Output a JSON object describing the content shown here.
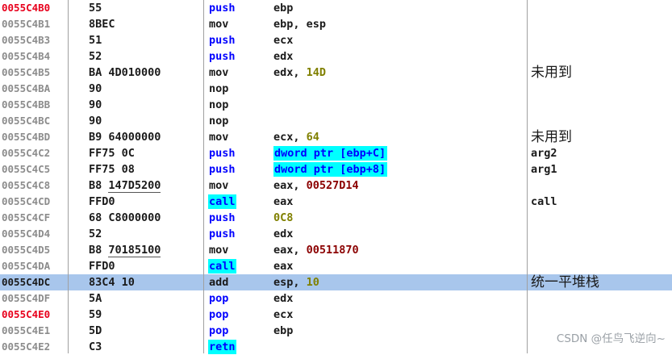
{
  "rows": [
    {
      "addr": "0055C4B0",
      "addr_style": "red",
      "hex": "55",
      "hex_ul": "",
      "mn": "push",
      "mn_style": "cyan",
      "op": [
        {
          "t": "ebp",
          "c": ""
        }
      ],
      "cm": "",
      "cm_cn": false,
      "selected": false
    },
    {
      "addr": "0055C4B1",
      "addr_style": "",
      "hex": "8BEC",
      "hex_ul": "",
      "mn": "mov",
      "mn_style": "",
      "op": [
        {
          "t": "ebp, esp",
          "c": ""
        }
      ],
      "cm": "",
      "cm_cn": false,
      "selected": false
    },
    {
      "addr": "0055C4B3",
      "addr_style": "",
      "hex": "51",
      "hex_ul": "",
      "mn": "push",
      "mn_style": "cyan",
      "op": [
        {
          "t": "ecx",
          "c": ""
        }
      ],
      "cm": "",
      "cm_cn": false,
      "selected": false
    },
    {
      "addr": "0055C4B4",
      "addr_style": "",
      "hex": "52",
      "hex_ul": "",
      "mn": "push",
      "mn_style": "cyan",
      "op": [
        {
          "t": "edx",
          "c": ""
        }
      ],
      "cm": "",
      "cm_cn": false,
      "selected": false
    },
    {
      "addr": "0055C4B5",
      "addr_style": "",
      "hex": "BA 4D010000",
      "hex_ul": "",
      "mn": "mov",
      "mn_style": "",
      "op": [
        {
          "t": "edx, ",
          "c": ""
        },
        {
          "t": "14D",
          "c": "num"
        }
      ],
      "cm": "未用到",
      "cm_cn": true,
      "selected": false
    },
    {
      "addr": "0055C4BA",
      "addr_style": "",
      "hex": "90",
      "hex_ul": "",
      "mn": "nop",
      "mn_style": "",
      "op": [],
      "cm": "",
      "cm_cn": false,
      "selected": false
    },
    {
      "addr": "0055C4BB",
      "addr_style": "",
      "hex": "90",
      "hex_ul": "",
      "mn": "nop",
      "mn_style": "",
      "op": [],
      "cm": "",
      "cm_cn": false,
      "selected": false
    },
    {
      "addr": "0055C4BC",
      "addr_style": "",
      "hex": "90",
      "hex_ul": "",
      "mn": "nop",
      "mn_style": "",
      "op": [],
      "cm": "",
      "cm_cn": false,
      "selected": false
    },
    {
      "addr": "0055C4BD",
      "addr_style": "",
      "hex": "B9 64000000",
      "hex_ul": "",
      "mn": "mov",
      "mn_style": "",
      "op": [
        {
          "t": "ecx, ",
          "c": ""
        },
        {
          "t": "64",
          "c": "num"
        }
      ],
      "cm": "未用到",
      "cm_cn": true,
      "selected": false
    },
    {
      "addr": "0055C4C2",
      "addr_style": "",
      "hex": "FF75 0C",
      "hex_ul": "",
      "mn": "push",
      "mn_style": "cyan",
      "op": [
        {
          "t": "dword ptr [ebp+C]",
          "c": "hlop"
        }
      ],
      "cm": "arg2",
      "cm_cn": false,
      "selected": false
    },
    {
      "addr": "0055C4C5",
      "addr_style": "",
      "hex": "FF75 08",
      "hex_ul": "",
      "mn": "push",
      "mn_style": "cyan",
      "op": [
        {
          "t": "dword ptr [ebp+8]",
          "c": "hlop"
        }
      ],
      "cm": "arg1",
      "cm_cn": false,
      "selected": false
    },
    {
      "addr": "0055C4C8",
      "addr_style": "",
      "hex": "B8 ",
      "hex_ul": "147D5200",
      "mn": "mov",
      "mn_style": "",
      "op": [
        {
          "t": "eax, ",
          "c": ""
        },
        {
          "t": "00527D14",
          "c": "addrnum"
        }
      ],
      "cm": "",
      "cm_cn": false,
      "selected": false
    },
    {
      "addr": "0055C4CD",
      "addr_style": "",
      "hex": "FFD0",
      "hex_ul": "",
      "mn": "call",
      "mn_style": "hl",
      "op": [
        {
          "t": "eax",
          "c": ""
        }
      ],
      "cm": "call",
      "cm_cn": false,
      "selected": false
    },
    {
      "addr": "0055C4CF",
      "addr_style": "",
      "hex": "68 C8000000",
      "hex_ul": "",
      "mn": "push",
      "mn_style": "cyan",
      "op": [
        {
          "t": "0C8",
          "c": "num"
        }
      ],
      "cm": "",
      "cm_cn": false,
      "selected": false
    },
    {
      "addr": "0055C4D4",
      "addr_style": "",
      "hex": "52",
      "hex_ul": "",
      "mn": "push",
      "mn_style": "cyan",
      "op": [
        {
          "t": "edx",
          "c": ""
        }
      ],
      "cm": "",
      "cm_cn": false,
      "selected": false
    },
    {
      "addr": "0055C4D5",
      "addr_style": "",
      "hex": "B8 ",
      "hex_ul": "70185100",
      "mn": "mov",
      "mn_style": "",
      "op": [
        {
          "t": "eax, ",
          "c": ""
        },
        {
          "t": "00511870",
          "c": "addrnum"
        }
      ],
      "cm": "",
      "cm_cn": false,
      "selected": false
    },
    {
      "addr": "0055C4DA",
      "addr_style": "",
      "hex": "FFD0",
      "hex_ul": "",
      "mn": "call",
      "mn_style": "hl",
      "op": [
        {
          "t": "eax",
          "c": ""
        }
      ],
      "cm": "",
      "cm_cn": false,
      "selected": false
    },
    {
      "addr": "0055C4DC",
      "addr_style": "dark",
      "hex": "83C4 10",
      "hex_ul": "",
      "mn": "add",
      "mn_style": "",
      "op": [
        {
          "t": "esp, ",
          "c": ""
        },
        {
          "t": "10",
          "c": "num"
        }
      ],
      "cm": "统一平堆栈",
      "cm_cn": true,
      "selected": true
    },
    {
      "addr": "0055C4DF",
      "addr_style": "",
      "hex": "5A",
      "hex_ul": "",
      "mn": "pop",
      "mn_style": "cyan",
      "op": [
        {
          "t": "edx",
          "c": ""
        }
      ],
      "cm": "",
      "cm_cn": false,
      "selected": false
    },
    {
      "addr": "0055C4E0",
      "addr_style": "red",
      "hex": "59",
      "hex_ul": "",
      "mn": "pop",
      "mn_style": "cyan",
      "op": [
        {
          "t": "ecx",
          "c": ""
        }
      ],
      "cm": "",
      "cm_cn": false,
      "selected": false
    },
    {
      "addr": "0055C4E1",
      "addr_style": "",
      "hex": "5D",
      "hex_ul": "",
      "mn": "pop",
      "mn_style": "cyan",
      "op": [
        {
          "t": "ebp",
          "c": ""
        }
      ],
      "cm": "",
      "cm_cn": false,
      "selected": false
    },
    {
      "addr": "0055C4E2",
      "addr_style": "",
      "hex": "C3",
      "hex_ul": "",
      "mn": "retn",
      "mn_style": "hl",
      "op": [],
      "cm": "",
      "cm_cn": false,
      "selected": false
    }
  ],
  "watermark": "CSDN @任鸟飞逆向~",
  "colors": {
    "selected_row_bg": "#a8c6ec",
    "mnemonic_highlight": "#00ffff",
    "mnemonic_text": "#0000ff",
    "breakpoint_addr": "#e8001c",
    "constant": "#808000",
    "address_constant": "#8b0000"
  }
}
